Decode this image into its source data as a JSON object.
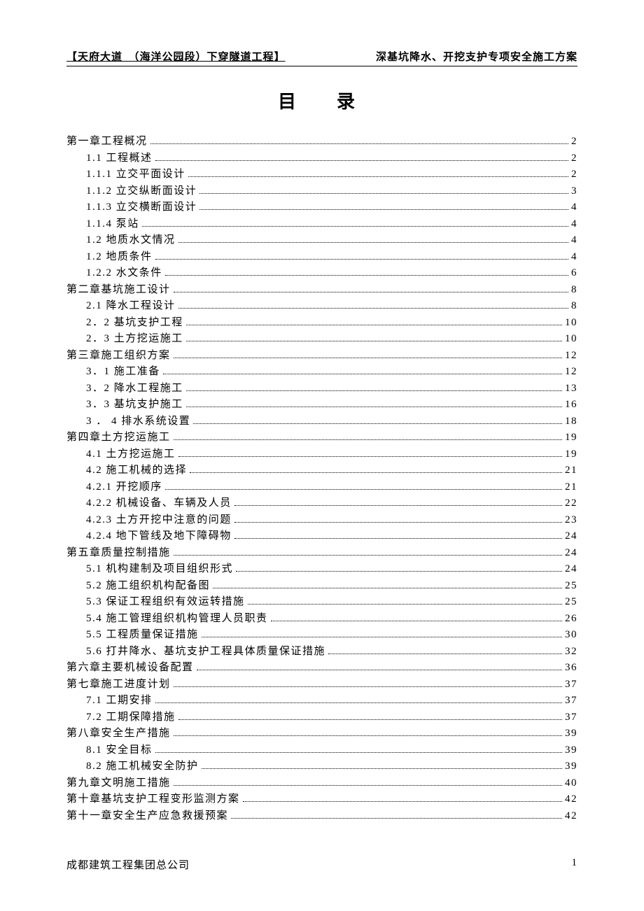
{
  "header": {
    "left": "【天府大道　（海洋公园段）下穿隧道工程】",
    "right": "深基坑降水、开挖支护专项安全施工方案"
  },
  "title": "目　录",
  "toc": [
    {
      "level": 0,
      "label": "第一章工程概况",
      "page": "2"
    },
    {
      "level": 1,
      "label": "1.1 工程概述",
      "page": "2"
    },
    {
      "level": 1,
      "label": "1.1.1 立交平面设计",
      "page": "2"
    },
    {
      "level": 1,
      "label": "1.1.2 立交纵断面设计",
      "page": "3"
    },
    {
      "level": 1,
      "label": "1.1.3 立交横断面设计",
      "page": "4"
    },
    {
      "level": 1,
      "label": "1.1.4 泵站",
      "page": "4"
    },
    {
      "level": 1,
      "label": "1.2 地质水文情况",
      "page": "4"
    },
    {
      "level": 1,
      "label": "1.2 地质条件",
      "page": "4"
    },
    {
      "level": 1,
      "label": "1.2.2 水文条件",
      "page": "6"
    },
    {
      "level": 0,
      "label": "第二章基坑施工设计",
      "page": "8"
    },
    {
      "level": 1,
      "label": "2.1 降水工程设计",
      "page": "8"
    },
    {
      "level": 1,
      "label": "2．2 基坑支护工程",
      "page": "10"
    },
    {
      "level": 1,
      "label": "2．3 土方挖运施工",
      "page": "10"
    },
    {
      "level": 0,
      "label": "第三章施工组织方案",
      "page": "12"
    },
    {
      "level": 1,
      "label": "3．1 施工准备",
      "page": "12"
    },
    {
      "level": 1,
      "label": "3．2 降水工程施工",
      "page": "13"
    },
    {
      "level": 1,
      "label": "3．3 基坑支护施工",
      "page": "16"
    },
    {
      "level": 1,
      "label": "3 ． 4 排水系统设置",
      "page": "18"
    },
    {
      "level": 0,
      "label": "第四章土方挖运施工",
      "page": "19"
    },
    {
      "level": 1,
      "label": "4.1 土方挖运施工",
      "page": "19"
    },
    {
      "level": 1,
      "label": "4.2 施工机械的选择",
      "page": "21"
    },
    {
      "level": 1,
      "label": "4.2.1 开挖顺序",
      "page": "21"
    },
    {
      "level": 1,
      "label": "4.2.2 机械设备、车辆及人员",
      "page": "22"
    },
    {
      "level": 1,
      "label": "4.2.3 土方开挖中注意的问题",
      "page": "23"
    },
    {
      "level": 1,
      "label": "4.2.4 地下管线及地下障碍物",
      "page": "24"
    },
    {
      "level": 0,
      "label": "第五章质量控制措施",
      "page": "24"
    },
    {
      "level": 1,
      "label": "5.1 机构建制及项目组织形式",
      "page": "24"
    },
    {
      "level": 1,
      "label": "5.2 施工组织机构配备图",
      "page": "25"
    },
    {
      "level": 1,
      "label": "5.3 保证工程组织有效运转措施",
      "page": "25"
    },
    {
      "level": 1,
      "label": "5.4 施工管理组织机构管理人员职责",
      "page": "26"
    },
    {
      "level": 1,
      "label": "5.5 工程质量保证措施",
      "page": "30"
    },
    {
      "level": 1,
      "label": "5.6 打井降水、基坑支护工程具体质量保证措施",
      "page": "32"
    },
    {
      "level": 0,
      "label": "第六章主要机械设备配置",
      "page": "36"
    },
    {
      "level": 0,
      "label": "第七章施工进度计划",
      "page": "37"
    },
    {
      "level": 1,
      "label": "7.1 工期安排",
      "page": "37"
    },
    {
      "level": 1,
      "label": "7.2 工期保障措施",
      "page": "37"
    },
    {
      "level": 0,
      "label": "第八章安全生产措施",
      "page": "39"
    },
    {
      "level": 1,
      "label": "8.1 安全目标",
      "page": "39"
    },
    {
      "level": 1,
      "label": "8.2 施工机械安全防护",
      "page": "39"
    },
    {
      "level": 0,
      "label": "第九章文明施工措施",
      "page": "40"
    },
    {
      "level": 0,
      "label": "第十章基坑支护工程变形监测方案",
      "page": "42"
    },
    {
      "level": 0,
      "label": "第十一章安全生产应急救援预案",
      "page": "42"
    }
  ],
  "footer": {
    "company": "成都建筑工程集团总公司",
    "page": "1"
  }
}
